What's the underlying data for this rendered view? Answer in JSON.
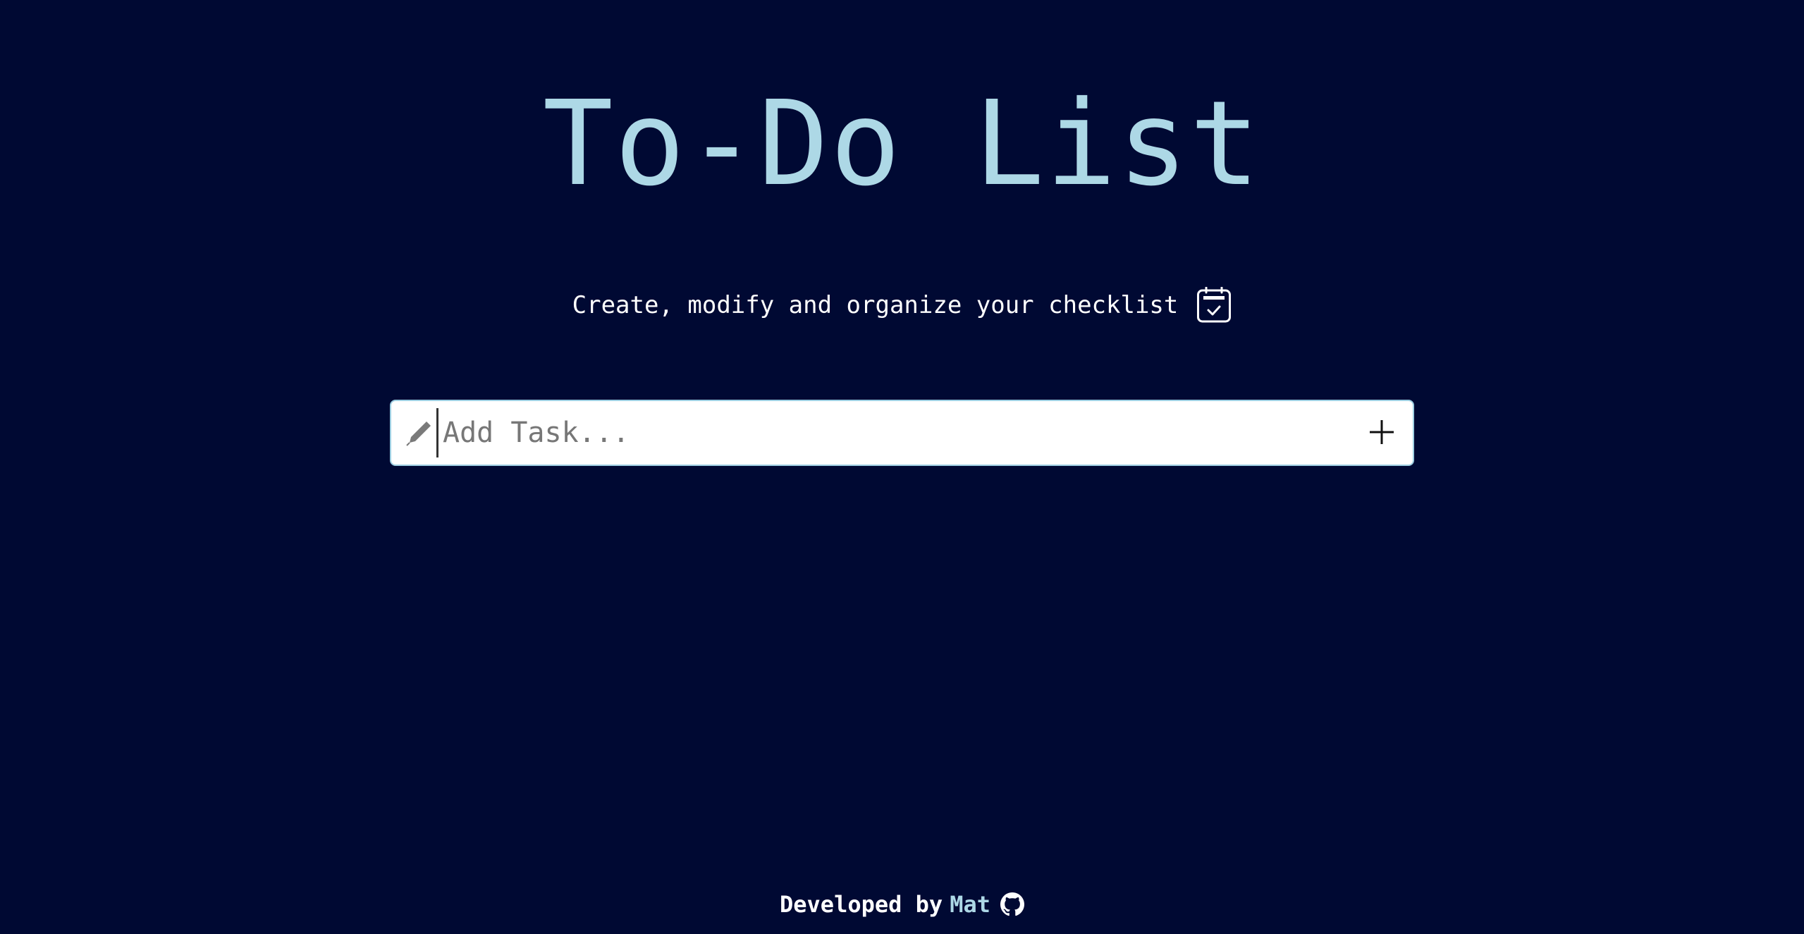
{
  "header": {
    "title": "To-Do List",
    "subtitle": "Create, modify and organize your checklist"
  },
  "task_form": {
    "placeholder": "Add Task...",
    "value": ""
  },
  "footer": {
    "prefix": "Developed by",
    "author": "Mat"
  },
  "icons": {
    "subtitle_icon": "calendar-check-icon",
    "input_icon": "pencil-icon",
    "add_icon": "plus-icon",
    "footer_icon": "github-icon"
  },
  "colors": {
    "background": "#000933",
    "title": "#add8e6",
    "text": "#ffffff",
    "accent": "#add8e6",
    "input_bg": "#ffffff",
    "input_border": "#9ecfe2"
  }
}
